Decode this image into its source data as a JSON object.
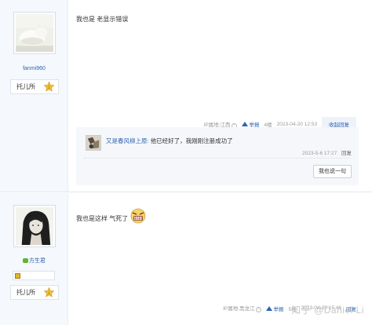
{
  "posts": [
    {
      "username": "fanmi960",
      "badge_label": "托儿所",
      "content": "我也是 老显示错误",
      "meta": {
        "ip": "IP属地:江西",
        "report": "举报",
        "floor": "4楼",
        "timestamp": "2023-04-20 12:53",
        "action": "收起回复"
      },
      "sub_replies": [
        {
          "user": "又是春风柳上原:",
          "text": "他已经好了，我刚刚注册成功了",
          "timestamp": "2023-5-6 17:27",
          "reply_label": "回复"
        }
      ],
      "say_button": "我也说一句"
    },
    {
      "username": "方生君",
      "badge_label": "托儿所",
      "content": "我也是这样 气死了",
      "meta": {
        "ip": "IP属地:黑龙江",
        "report": "举报",
        "floor": "5楼",
        "timestamp": "2023-04-20 15:46",
        "action": "回复"
      }
    }
  ],
  "watermark": "知乎 @Daniel Li",
  "colors": {
    "link": "#2d64b3",
    "sidebar_bg": "#f5f8fc",
    "subbox_bg": "#f5f7fa",
    "vip_green": "#5fb52f"
  },
  "icons": {
    "level": "level-star-badge-icon",
    "report": "report-triangle-icon",
    "help": "question-circle-icon",
    "emoji": "angry-face-emoji-icon",
    "vip": "vip-icon"
  }
}
